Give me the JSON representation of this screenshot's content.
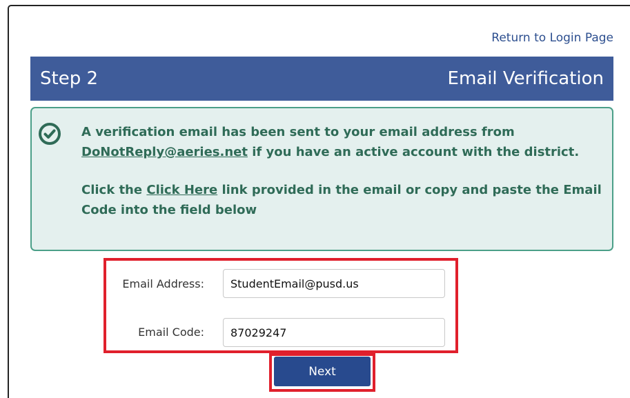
{
  "header": {
    "return_link": "Return to Login Page"
  },
  "step": {
    "label": "Step 2",
    "title": "Email Verification",
    "color": "#3f5c9a"
  },
  "notice": {
    "icon": "check-circle-icon",
    "line1_prefix": "A verification email has been sent to your email address from",
    "sender_email": "DoNotReply@aeries.net",
    "line1_suffix": " if you have an active account with the district.",
    "line2_prefix": "Click the ",
    "click_here": "Click Here",
    "line2_suffix": " link provided in the email or copy and paste the Email Code into the field below",
    "color": "#2f6b57",
    "background": "#e4f0ee"
  },
  "form": {
    "email_label": "Email Address:",
    "email_value": "StudentEmail@pusd.us",
    "code_label": "Email Code:",
    "code_value": "87029247",
    "highlight_color": "#e0202c"
  },
  "actions": {
    "next_label": "Next",
    "button_color": "#284a8e"
  }
}
